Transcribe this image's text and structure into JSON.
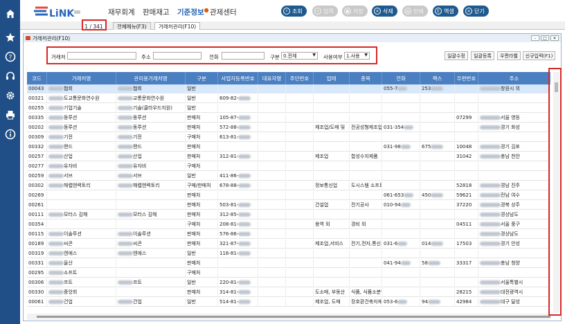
{
  "colors": {
    "sidebar": "#1f4f86",
    "accent": "#1d5fb3",
    "header": "#4a7fc1",
    "highlight": "#d92626"
  },
  "sidebar": {
    "icons": [
      "home-icon",
      "star-icon",
      "help-icon",
      "headset-icon",
      "gear-icon",
      "printer-icon",
      "info-icon"
    ]
  },
  "app": {
    "logo": "LiNK"
  },
  "menu": [
    "재무회계",
    "판매재고",
    "기준정보",
    "관제센터"
  ],
  "toolbar": [
    {
      "label": "조회",
      "icon": "search",
      "enabled": true
    },
    {
      "label": "입력",
      "icon": "plus",
      "enabled": false
    },
    {
      "label": "저장",
      "icon": "save",
      "enabled": false
    },
    {
      "label": "삭제",
      "icon": "trash",
      "enabled": true
    },
    {
      "label": "인쇄",
      "icon": "print",
      "enabled": false
    },
    {
      "label": "엑셀",
      "icon": "excel",
      "enabled": true
    },
    {
      "label": "닫기",
      "icon": "close",
      "enabled": true
    }
  ],
  "tabs": {
    "pager": "1 / 341",
    "items": [
      "전체메뉴(F3)",
      "거래처관리(F10)"
    ]
  },
  "window": {
    "title": "거래처관리(F10)"
  },
  "filter": {
    "partner_label": "거래처",
    "address_label": "주소",
    "phone_label": "전화",
    "type_label": "구분",
    "type_value": "0.전체",
    "use_label": "사용여부",
    "use_value": "1.사용"
  },
  "actions": [
    "일괄수정",
    "일괄등록",
    "우편라벨",
    "신규입력(F1)"
  ],
  "columns": [
    "코드",
    "거래처명",
    "관리용거래처명",
    "구분",
    "사업자등록번호",
    "대표자명",
    "주민번호",
    "업태",
    "종목",
    "전화",
    "팩스",
    "우편번호",
    "주소"
  ],
  "rows": [
    {
      "code": "00043",
      "name": "협회",
      "mgmt": "협회",
      "type": "일반",
      "biz": "",
      "rep": "",
      "jumin": "",
      "industry": "",
      "item": "",
      "phone": "055-7",
      "fax": "253",
      "zip": "",
      "addr": "창원시 의"
    },
    {
      "code": "00321",
      "name": "도교통문화연수원",
      "mgmt": "교통문화연수원",
      "type": "일반",
      "biz": "609-82-",
      "rep": "",
      "jumin": "",
      "industry": "",
      "item": "",
      "phone": "",
      "fax": "",
      "zip": "",
      "addr": ""
    },
    {
      "code": "00255",
      "name": "기업기술",
      "mgmt": "기술(클라우드지원)",
      "type": "일반",
      "biz": "",
      "rep": "",
      "jumin": "",
      "industry": "",
      "item": "",
      "phone": "",
      "fax": "",
      "zip": "",
      "addr": ""
    },
    {
      "code": "00335",
      "name": "동루션",
      "mgmt": "동루션",
      "type": "판매처",
      "biz": "105-87-",
      "rep": "",
      "jumin": "",
      "industry": "",
      "item": "",
      "phone": "",
      "fax": "",
      "zip": "07299",
      "addr": "서울 영등"
    },
    {
      "code": "00202",
      "name": "동루션",
      "mgmt": "동루션",
      "type": "판매처",
      "biz": "572-88-",
      "rep": "",
      "jumin": "",
      "industry": "제조업/도매 및",
      "item": "전공성형제조업,",
      "phone": "031-354",
      "fax": "",
      "zip": "",
      "addr": "경기 화성"
    },
    {
      "code": "00309",
      "name": "기전",
      "mgmt": "기전",
      "type": "구매처",
      "biz": "613-81-",
      "rep": "",
      "jumin": "",
      "industry": "",
      "item": "",
      "phone": "",
      "fax": "",
      "zip": "",
      "addr": ""
    },
    {
      "code": "00332",
      "name": "랜드",
      "mgmt": "랜드",
      "type": "판매처",
      "biz": "",
      "rep": "",
      "jumin": "",
      "industry": "",
      "item": "",
      "phone": "031-98",
      "fax": "675",
      "zip": "10048",
      "addr": "경기 김포"
    },
    {
      "code": "00257",
      "name": "산업",
      "mgmt": "산업",
      "type": "판매처",
      "biz": "312-81-",
      "rep": "",
      "jumin": "",
      "industry": "제조업",
      "item": "합성수지제품",
      "phone": "",
      "fax": "",
      "zip": "31042",
      "addr": "충남 천안"
    },
    {
      "code": "00277",
      "name": "유자비",
      "mgmt": "유자비",
      "type": "구매처",
      "biz": "",
      "rep": "",
      "jumin": "",
      "industry": "",
      "item": "",
      "phone": "",
      "fax": "",
      "zip": "",
      "addr": ""
    },
    {
      "code": "00259",
      "name": "서브",
      "mgmt": "서브",
      "type": "일반",
      "biz": "411-86-",
      "rep": "",
      "jumin": "",
      "industry": "",
      "item": "",
      "phone": "",
      "fax": "",
      "zip": "",
      "addr": ""
    },
    {
      "code": "00302",
      "name": "해렙엔력토리",
      "mgmt": "해렙엔력토리",
      "type": "구매/판매처",
      "biz": "678-88-",
      "rep": "",
      "jumin": "",
      "industry": "정보통신업",
      "item": "도시스템 소프트웨",
      "phone": "",
      "fax": "",
      "zip": "52818",
      "addr": "경남 진주"
    },
    {
      "code": "00269",
      "name": "",
      "mgmt": "",
      "type": "판매처",
      "biz": "",
      "rep": "",
      "jumin": "",
      "industry": "",
      "item": "",
      "phone": "061-653",
      "fax": "450",
      "zip": "59621",
      "addr": "전남 여수"
    },
    {
      "code": "00261",
      "name": "",
      "mgmt": "",
      "type": "판매처",
      "biz": "503-81-",
      "rep": "",
      "jumin": "",
      "industry": "건설업",
      "item": "전기공사",
      "phone": "010-94",
      "fax": "",
      "zip": "37220",
      "addr": "경북 상주"
    },
    {
      "code": "00111",
      "name": "모터스 김해",
      "mgmt": "모터스 김해",
      "type": "판매처",
      "biz": "312-85-",
      "rep": "",
      "jumin": "",
      "industry": "",
      "item": "",
      "phone": "",
      "fax": "",
      "zip": "",
      "addr": "경상남도"
    },
    {
      "code": "00354",
      "name": "",
      "mgmt": "",
      "type": "구매처",
      "biz": "208-81-",
      "rep": "",
      "jumin": "",
      "industry": "용역 외",
      "item": "경비 외",
      "phone": "",
      "fax": "",
      "zip": "04511",
      "addr": "서울 중구"
    },
    {
      "code": "00115",
      "name": "이솔루션",
      "mgmt": "이솔루션",
      "type": "판매처",
      "biz": "576-86-",
      "rep": "",
      "jumin": "",
      "industry": "",
      "item": "",
      "phone": "",
      "fax": "",
      "zip": "",
      "addr": "경상남도"
    },
    {
      "code": "00189",
      "name": "씨콘",
      "mgmt": "씨콘",
      "type": "판매처",
      "biz": "321-87-",
      "rep": "",
      "jumin": "",
      "industry": "제조업,서비스",
      "item": "전기,전자,통신기기",
      "phone": "031-6",
      "fax": "014",
      "zip": "17503",
      "addr": "경기 안성"
    },
    {
      "code": "00319",
      "name": "엔에스",
      "mgmt": "엔에스",
      "type": "일반",
      "biz": "116-81-",
      "rep": "",
      "jumin": "",
      "industry": "",
      "item": "",
      "phone": "",
      "fax": "",
      "zip": "",
      "addr": ""
    },
    {
      "code": "00331",
      "name": "울산",
      "mgmt": "",
      "type": "판매처",
      "biz": "",
      "rep": "",
      "jumin": "",
      "industry": "",
      "item": "",
      "phone": "041-94",
      "fax": "58",
      "zip": "33317",
      "addr": "충남 청양"
    },
    {
      "code": "00295",
      "name": "소프트",
      "mgmt": "",
      "type": "구매처",
      "biz": "",
      "rep": "",
      "jumin": "",
      "industry": "",
      "item": "",
      "phone": "",
      "fax": "",
      "zip": "",
      "addr": ""
    },
    {
      "code": "00306",
      "name": "프트",
      "mgmt": "프트",
      "type": "일반",
      "biz": "220-81-",
      "rep": "",
      "jumin": "",
      "industry": "",
      "item": "",
      "phone": "",
      "fax": "",
      "zip": "",
      "addr": "서울특별시"
    },
    {
      "code": "00330",
      "name": "중앙회",
      "mgmt": "",
      "type": "판매처",
      "biz": "314-81-",
      "rep": "",
      "jumin": "",
      "industry": "도소매, 부동산",
      "item": "식품, 식품소분업,",
      "phone": "",
      "fax": "",
      "zip": "28215",
      "addr": "대전광역시"
    },
    {
      "code": "00061",
      "name": "건업",
      "mgmt": "건업",
      "type": "일반",
      "biz": "514-81-",
      "rep": "",
      "jumin": "",
      "industry": "제조업, 도매",
      "item": "장호환건축자재,",
      "phone": "053-6",
      "fax": "94",
      "zip": "42984",
      "addr": "대구 달성"
    }
  ]
}
